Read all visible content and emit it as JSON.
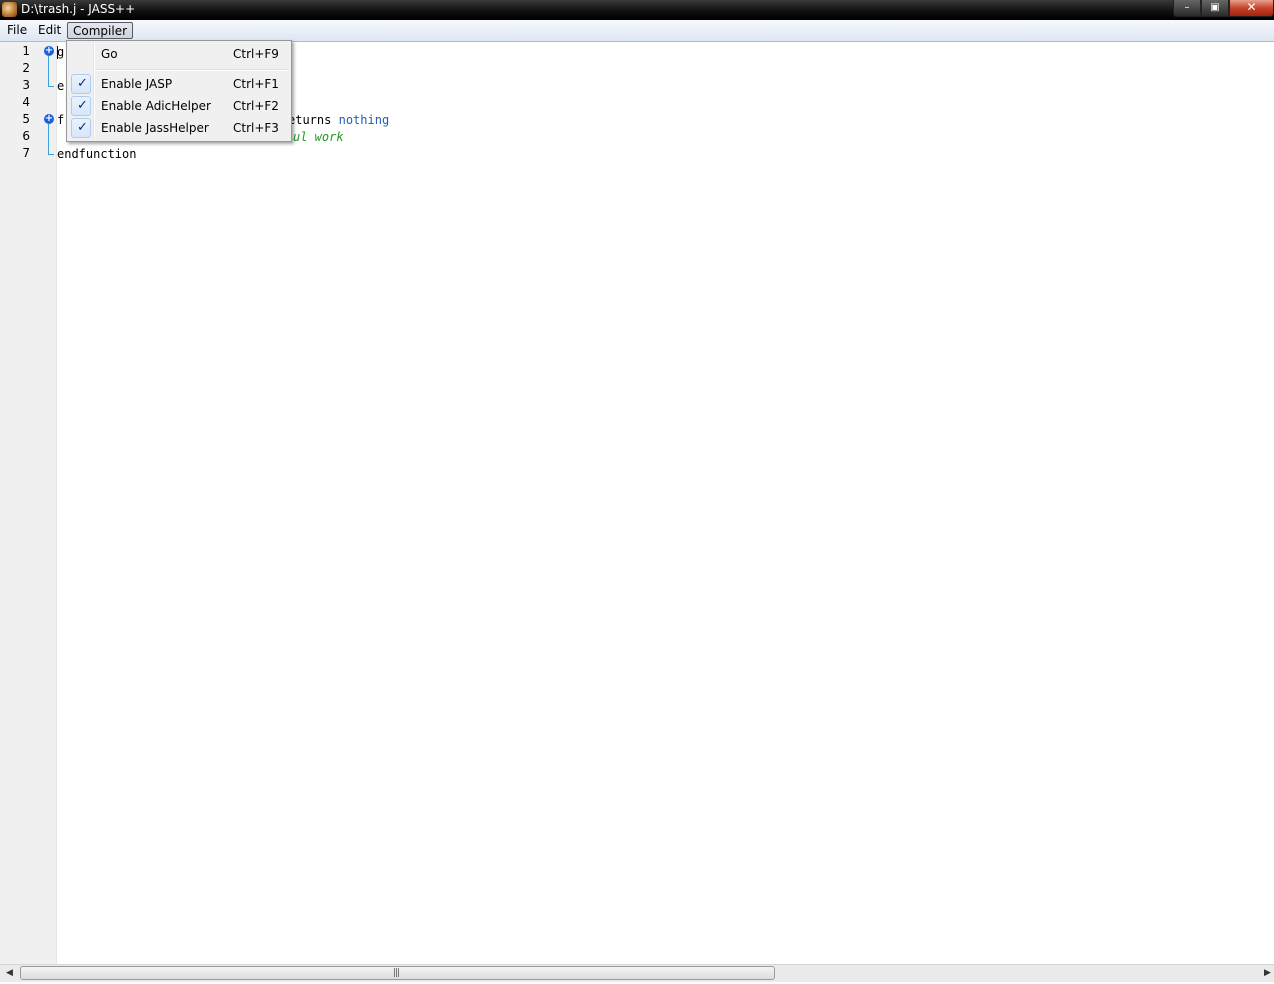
{
  "window": {
    "title": "D:\\trash.j - JASS++",
    "minimize_glyph": "–",
    "maximize_glyph": "▣",
    "close_glyph": "✕"
  },
  "menubar": {
    "items": [
      {
        "label": "File"
      },
      {
        "label": "Edit"
      },
      {
        "label": "Compiler"
      }
    ]
  },
  "editor": {
    "line_numbers": [
      "1",
      "2",
      "3",
      "4",
      "5",
      "6",
      "7"
    ],
    "lines": {
      "l1": "g",
      "l3": "e",
      "l5_start": "f",
      "l5_kw": "eturns",
      "l5_type": "nothing",
      "l6_comment": "ul work",
      "l7": "endfunction"
    }
  },
  "compiler_menu": {
    "items": [
      {
        "label": "Go",
        "shortcut": "Ctrl+F9",
        "checked": false
      },
      {
        "label": "Enable JASP",
        "shortcut": "Ctrl+F1",
        "checked": true
      },
      {
        "label": "Enable AdicHelper",
        "shortcut": "Ctrl+F2",
        "checked": true
      },
      {
        "label": "Enable JassHelper",
        "shortcut": "Ctrl+F3",
        "checked": true
      }
    ],
    "check_glyph": "✓"
  },
  "scrollbar": {
    "left_arrow": "◀",
    "right_arrow": "▶",
    "grip": "|||"
  },
  "colors": {
    "keyword_type": "#1d5fb8",
    "comment": "#229922",
    "fold_marker": "#1a5fe0"
  }
}
